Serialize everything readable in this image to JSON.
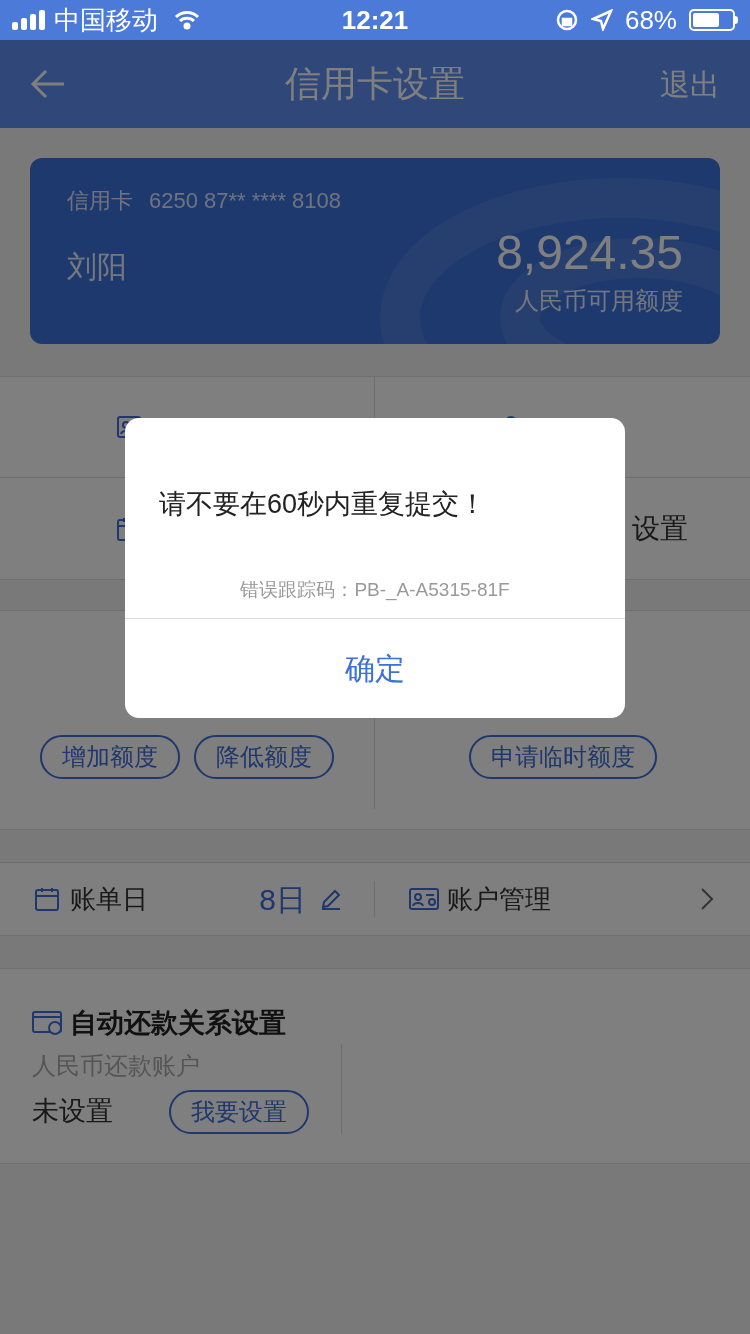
{
  "status_bar": {
    "carrier": "中国移动",
    "time": "12:21",
    "battery": "68%"
  },
  "nav": {
    "title": "信用卡设置",
    "action": "退出"
  },
  "card": {
    "label": "信用卡",
    "number": "6250 87** **** 8108",
    "holder": "刘阳",
    "amount": "8,924.35",
    "amount_label": "人民币可用额度"
  },
  "menu": [
    {
      "kind": "profile"
    },
    {
      "kind": "lock"
    },
    {
      "kind": "calendar"
    },
    {
      "kind": "none",
      "label": "设置"
    }
  ],
  "limits": [
    {
      "buttons": [
        "增加额度",
        "降低额度"
      ]
    },
    {
      "buttons": [
        "申请临时额度"
      ]
    }
  ],
  "billing": {
    "label": "账单日",
    "value": "8日"
  },
  "account": {
    "label": "账户管理"
  },
  "autopay": {
    "title": "自动还款关系设置",
    "subtitle": "人民币还款账户",
    "status": "未设置",
    "button": "我要设置"
  },
  "dialog": {
    "message": "请不要在60秒内重复提交！",
    "trace": "错误跟踪码：PB-_A-A5315-81F",
    "button": "确定"
  }
}
